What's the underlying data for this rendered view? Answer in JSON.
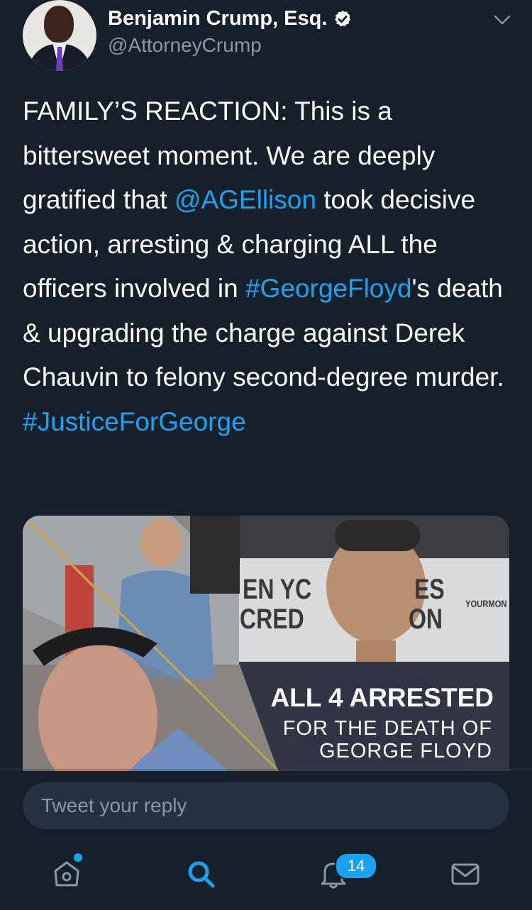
{
  "user": {
    "name": "Benjamin Crump, Esq.",
    "handle": "@AttorneyCrump",
    "verified": true
  },
  "tweet": {
    "segments": [
      {
        "text": "FAMILY’S REACTION: This is a bittersweet moment. We are deeply gratified that ",
        "type": "text"
      },
      {
        "text": "@AGEllison",
        "type": "mention"
      },
      {
        "text": " took decisive action, arresting & charging ALL the officers involved in ",
        "type": "text"
      },
      {
        "text": "#GeorgeFloyd",
        "type": "hashtag"
      },
      {
        "text": "'s death & upgrading the charge against Derek Chauvin to felony second-degree murder. ",
        "type": "text"
      },
      {
        "text": "#JusticeForGeorge",
        "type": "hashtag"
      }
    ]
  },
  "media": {
    "headline": "ALL 4 ARRESTED",
    "subline_1": "FOR THE DEATH OF",
    "subline_2": "GEORGE FLOYD",
    "sign_line_1": "EN YC",
    "sign_line_2": "CRED",
    "sign_suffix_1": "ES",
    "sign_suffix_2": "ON",
    "sign_brand": "YOURMON"
  },
  "reply": {
    "placeholder": "Tweet your reply"
  },
  "nav": {
    "items": [
      "home-icon",
      "search-icon",
      "notifications-icon",
      "messages-icon"
    ],
    "notifications_badge": "14"
  },
  "colors": {
    "background": "#15202b",
    "link": "#1da1f2",
    "secondary_text": "#8899a6",
    "input_bg": "#253341"
  }
}
